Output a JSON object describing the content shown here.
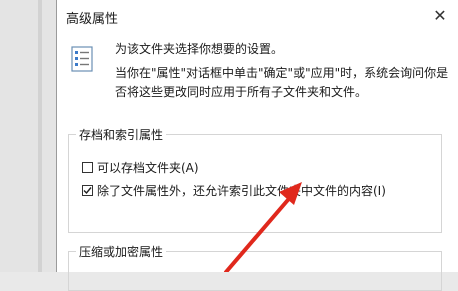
{
  "dialog": {
    "title": "高级属性",
    "close_symbol": "✕",
    "description_line1": "为该文件夹选择你想要的设置。",
    "description_line2": "当你在\"属性\"对话框中单击\"确定\"或\"应用\"时，系统会询问你是否将这些更改同时应用于所有子文件夹和文件。"
  },
  "archive_group": {
    "label": "存档和索引属性",
    "options": [
      {
        "label": "可以存档文件夹(A)",
        "checked": false
      },
      {
        "label": "除了文件属性外，还允许索引此文件夹中文件的内容(I)",
        "checked": true
      }
    ]
  },
  "compress_group": {
    "label": "压缩或加密属性"
  },
  "colors": {
    "annotation_arrow": "#e0281c"
  }
}
